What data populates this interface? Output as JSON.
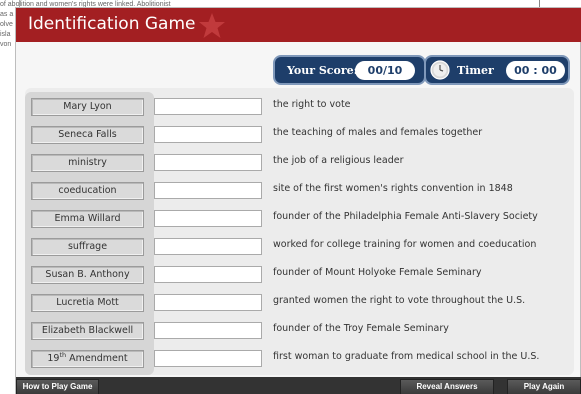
{
  "background_doc": {
    "lines": [
      "of abolition and women's rights were linked. Abolitionist",
      "as a",
      "olve",
      "isla",
      "von"
    ]
  },
  "header": {
    "title": "Identification Game",
    "colors": {
      "title_bar": "#a31f22",
      "pill": "#1e3e6a"
    }
  },
  "score": {
    "label": "Your Score:",
    "value": "00/10"
  },
  "timer": {
    "label": "Timer",
    "value": "00 : 00"
  },
  "rows": [
    {
      "term": "Mary Lyon",
      "answer": "",
      "definition": "the right to vote"
    },
    {
      "term": "Seneca Falls",
      "answer": "",
      "definition": "the teaching of males and females together"
    },
    {
      "term": "ministry",
      "answer": "",
      "definition": "the job of a religious leader"
    },
    {
      "term": "coeducation",
      "answer": "",
      "definition": "site of the first women's rights convention in 1848"
    },
    {
      "term": "Emma Willard",
      "answer": "",
      "definition": "founder of the Philadelphia Female Anti-Slavery Society"
    },
    {
      "term": "suffrage",
      "answer": "",
      "definition": "worked for college training for women and coeducation"
    },
    {
      "term": "Susan B. Anthony",
      "answer": "",
      "definition": "founder of Mount Holyoke Female Seminary"
    },
    {
      "term": "Lucretia Mott",
      "answer": "",
      "definition": "granted women the right to vote throughout the U.S."
    },
    {
      "term": "Elizabeth Blackwell",
      "answer": "",
      "definition": "founder of the Troy Female Seminary"
    },
    {
      "term_base": "19",
      "term_sup": "th",
      "term_rest": " Amendment",
      "answer": "",
      "definition": "first woman to graduate from medical school in the U.S."
    }
  ],
  "footer": {
    "how_to_play": "How to Play Game",
    "reveal": "Reveal Answers",
    "play_again": "Play Again"
  },
  "icons": {
    "title_decoration": "star-icon",
    "timer": "clock-icon"
  }
}
